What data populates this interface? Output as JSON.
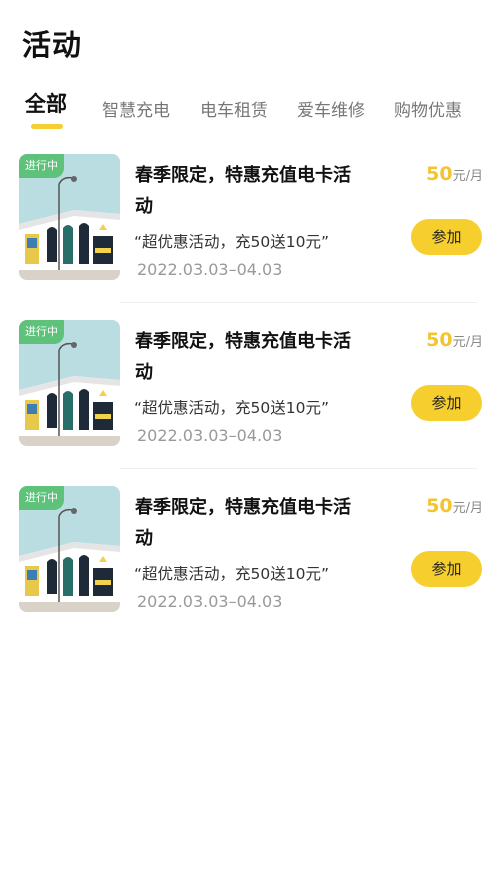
{
  "page": {
    "title": "活动"
  },
  "tabs": [
    {
      "label": "全部",
      "active": true
    },
    {
      "label": "智慧充电",
      "active": false
    },
    {
      "label": "电车租赁",
      "active": false
    },
    {
      "label": "爱车维修",
      "active": false
    },
    {
      "label": "购物优惠",
      "active": false
    }
  ],
  "activities": [
    {
      "status": "进行中",
      "title": "春季限定，特惠充值电卡活动",
      "quote": "“超优惠活动，充50送10元”",
      "date": "2022.03.03–04.03",
      "price": "50",
      "price_unit": "元/月",
      "button": "参加"
    },
    {
      "status": "进行中",
      "title": "春季限定，特惠充值电卡活动",
      "quote": "“超优惠活动，充50送10元”",
      "date": "2022.03.03–04.03",
      "price": "50",
      "price_unit": "元/月",
      "button": "参加"
    },
    {
      "status": "进行中",
      "title": "春季限定，特惠充值电卡活动",
      "quote": "“超优惠活动，充50送10元”",
      "date": "2022.03.03–04.03",
      "price": "50",
      "price_unit": "元/月",
      "button": "参加"
    }
  ],
  "colors": {
    "accent": "#f6cf2f",
    "price": "#f4c430",
    "status_badge": "#5ec27a"
  }
}
